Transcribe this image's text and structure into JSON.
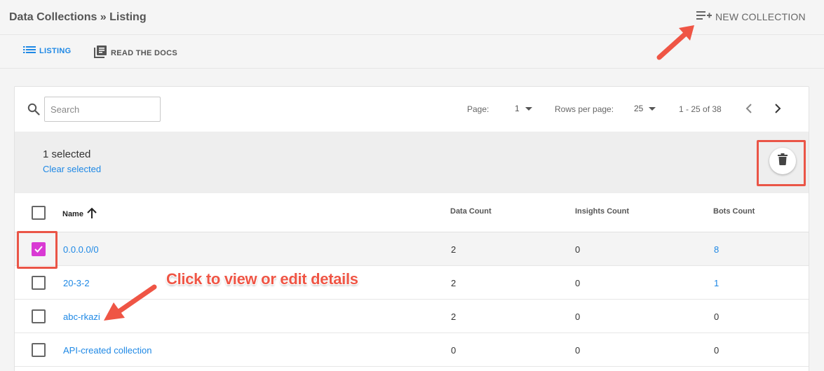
{
  "header": {
    "breadcrumb": "Data Collections » Listing",
    "new_collection_label": "NEW COLLECTION"
  },
  "subnav": {
    "listing_label": "LISTING",
    "docs_label": "READ THE DOCS"
  },
  "toolbar": {
    "search_placeholder": "Search",
    "page_label": "Page:",
    "page_value": "1",
    "rows_label": "Rows per page:",
    "rows_value": "25",
    "range_label": "1 - 25 of 38"
  },
  "selection": {
    "count_label": "1 selected",
    "clear_label": "Clear selected"
  },
  "table": {
    "columns": [
      "Name",
      "Data Count",
      "Insights Count",
      "Bots Count"
    ],
    "rows": [
      {
        "name": "0.0.0.0/0",
        "data_count": "2",
        "insights_count": "0",
        "bots_count": "8",
        "checked": true
      },
      {
        "name": "20-3-2",
        "data_count": "2",
        "insights_count": "0",
        "bots_count": "1",
        "checked": false
      },
      {
        "name": "abc-rkazi",
        "data_count": "2",
        "insights_count": "0",
        "bots_count": "0",
        "checked": false
      },
      {
        "name": "API-created collection",
        "data_count": "0",
        "insights_count": "0",
        "bots_count": "0",
        "checked": false
      }
    ]
  },
  "annotation": {
    "text": "Click to view or edit details"
  },
  "colors": {
    "accent": "#1e88e5",
    "checkbox_checked": "#d93ad4",
    "annotation": "#ef5545"
  }
}
